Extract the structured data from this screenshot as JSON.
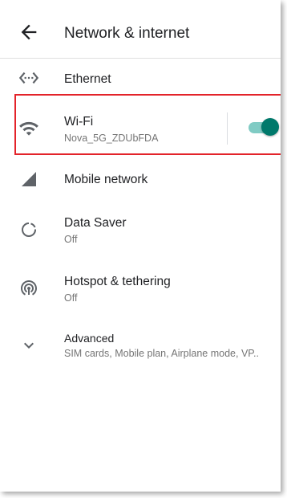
{
  "header": {
    "title": "Network & internet",
    "back_icon": "arrow-back-icon"
  },
  "items": [
    {
      "label": "Ethernet",
      "icon": "ethernet-icon"
    },
    {
      "label": "Wi-Fi",
      "subtitle": "Nova_5G_ZDUbFDA",
      "icon": "wifi-icon",
      "toggle_on": true
    },
    {
      "label": "Mobile network",
      "icon": "signal-icon"
    },
    {
      "label": "Data Saver",
      "subtitle": "Off",
      "icon": "data-saver-icon"
    },
    {
      "label": "Hotspot & tethering",
      "subtitle": "Off",
      "icon": "hotspot-icon"
    },
    {
      "label": "Advanced",
      "subtitle": "SIM cards, Mobile plan, Airplane mode, VP..",
      "icon": "chevron-down-icon"
    }
  ],
  "colors": {
    "accent": "#00796b",
    "accent_track": "#80cbc4",
    "highlight": "#e3232a",
    "icon": "#5f6368"
  }
}
